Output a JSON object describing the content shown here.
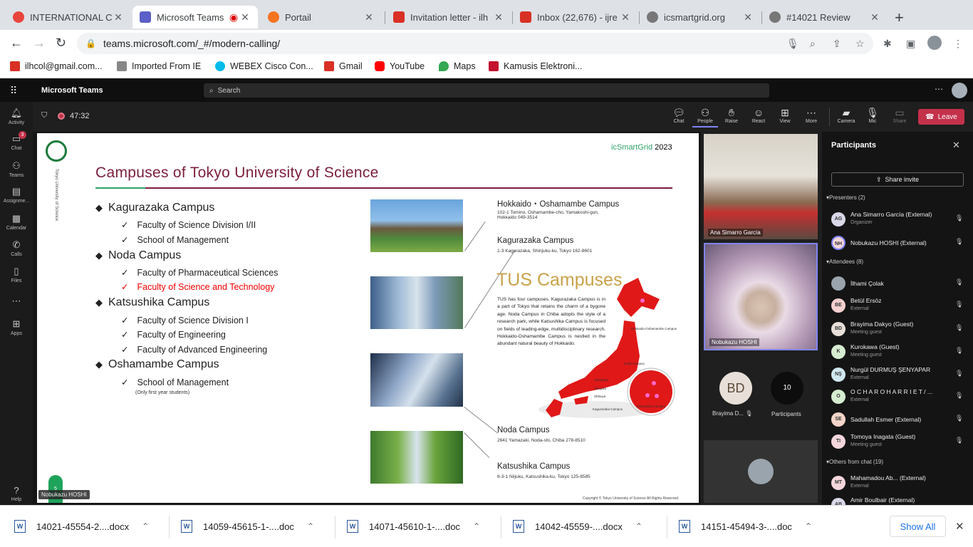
{
  "browser": {
    "tabs": [
      {
        "title": "INTERNATIONAL CO",
        "color": "#e8453c",
        "active": false
      },
      {
        "title": "Microsoft Teams",
        "color": "#5b5fc7",
        "active": true
      },
      {
        "title": "Portail",
        "color": "#f47421",
        "active": false
      },
      {
        "title": "Invitation letter - ilh",
        "color": "#d93025",
        "active": false
      },
      {
        "title": "Inbox (22,676) - ijre",
        "color": "#d93025",
        "active": false
      },
      {
        "title": "icsmartgrid.org",
        "color": "#777777",
        "active": false
      },
      {
        "title": "#14021 Review",
        "color": "#777777",
        "active": false
      }
    ],
    "url": "teams.microsoft.com/_#/modern-calling/",
    "bookmarks": [
      {
        "label": "ilhcol@gmail.com...",
        "color": "#d93025"
      },
      {
        "label": "Imported From IE",
        "color": "#888888"
      },
      {
        "label": "WEBEX Cisco Con...",
        "color": "#00bceb"
      },
      {
        "label": "Gmail",
        "color": "#d93025"
      },
      {
        "label": "YouTube",
        "color": "#ff0000"
      },
      {
        "label": "Maps",
        "color": "#34a853"
      },
      {
        "label": "Kamusis Elektroni...",
        "color": "#c4122f"
      }
    ]
  },
  "teams": {
    "app_name": "Microsoft Teams",
    "search_placeholder": "Search",
    "rail": [
      "Activity",
      "Chat",
      "Teams",
      "Assignme...",
      "Calendar",
      "Calls",
      "Files",
      "Apps",
      "Help"
    ],
    "chat_badge": "3",
    "meeting_time": "47:32",
    "controls": [
      "Chat",
      "People",
      "Raise",
      "React",
      "View",
      "More",
      "Camera",
      "Mic",
      "Share"
    ],
    "leave_label": "Leave"
  },
  "slide": {
    "brand_prefix": "icSmartGrid",
    "brand_year": "2023",
    "vertical_label": "Tokyo University of Science",
    "title": "Campuses of Tokyo University of Science",
    "campuses": [
      {
        "name": "Kagurazaka Campus",
        "faculties": [
          "Faculty of Science Division I/II",
          "School of Management"
        ]
      },
      {
        "name": "Noda Campus",
        "faculties": [
          "Faculty of Pharmaceutical Sciences",
          "Faculty of Science and Technology"
        ]
      },
      {
        "name": "Katsushika Campus",
        "faculties": [
          "Faculty of Science Division I",
          "Faculty of Engineering",
          "Faculty of Advanced Engineering"
        ]
      },
      {
        "name": "Oshamambe Campus",
        "faculties": [
          "School of Management"
        ],
        "note": "(Only first year students)"
      }
    ],
    "locations": [
      {
        "name": "Hokkaido・Oshamambe Campus",
        "address": "102-1 Tomino, Oshamambe-cho, Yamakoshi-gun, Hokkaido 049-3514"
      },
      {
        "name": "Kagurazaka Campus",
        "address": "1-3 Kagurazaka, Shinjuku-ku, Tokyo 162-8601"
      },
      {
        "name": "Noda Campus",
        "address": "2641 Yamazaki, Noda-shi, Chiba 278-8510"
      },
      {
        "name": "Katsushika Campus",
        "address": "6-3-1 Niijuku, Katsushika-ku, Tokyo 125-8585"
      }
    ],
    "tus_heading": "TUS Campuses",
    "tus_text": "TUS has four campuses. Kagurazaka Campus is in a part of Tokyo that retains the charm of a bygone age. Noda Campus in Chiba adopts the style of a research park, while Katsushika Campus is focused on fields of leading-edge, multidisciplinary research. Hokkaido-Oshamambe Campus is nestled in the abundant natural beauty of Hokkaido.",
    "map_labels": [
      "Hokkaido-Oshamambe Campus",
      "Noda Campus",
      "Akihabara",
      "Shinjuku",
      "Shibuya",
      "Kagurazaka Campus",
      "Katsushika Campus"
    ],
    "copyright": "Copyright © Tokyo University of Science All Rights Reserved.",
    "page_number": "5",
    "presenter_tag": "Nobukazu HOSHI"
  },
  "gallery": {
    "video1_name": "Ana Simarro García",
    "video2_name": "Nobukazu HOSHI",
    "bd_initials": "BD",
    "bd_name": "Brayima D...",
    "participant_count": "10",
    "participant_label": "Participants"
  },
  "participants": {
    "title": "Participants",
    "share_invite": "Share invite",
    "presenters_header": "Presenters (2)",
    "attendees_header": "Attendees (8)",
    "others_header": "Others from chat (19)",
    "presenters": [
      {
        "initials": "AG",
        "name": "Ana Simarro García (External)",
        "role": "Organizer",
        "color": "#d8d8e8"
      },
      {
        "initials": "NH",
        "name": "Nobukazu HOSHI (External)",
        "role": "",
        "color": "#f3d6dc"
      }
    ],
    "attendees": [
      {
        "initials": "",
        "name": "İlhami Çolak",
        "role": "",
        "color": "#9aa4ad"
      },
      {
        "initials": "BE",
        "name": "Betül Ersöz",
        "role": "External",
        "color": "#f7d0d0"
      },
      {
        "initials": "BD",
        "name": "Brayima Dakyo (Guest)",
        "role": "Meeting guest",
        "color": "#e8e0d8"
      },
      {
        "initials": "K",
        "name": "Kurokawa (Guest)",
        "role": "Meeting guest",
        "color": "#d6ecd0"
      },
      {
        "initials": "NŞ",
        "name": "Nurgül DURMUŞ ŞENYAPAR",
        "role": "External",
        "color": "#d0e8f0"
      },
      {
        "initials": "O",
        "name": "O C H A R O H A R R I E T / ...",
        "role": "External",
        "color": "#d6ecd0"
      },
      {
        "initials": "SE",
        "name": "Sadullah Esmer (External)",
        "role": "",
        "color": "#f5d5c8"
      },
      {
        "initials": "TI",
        "name": "Tomoya Inagata (Guest)",
        "role": "Meeting guest",
        "color": "#f3d6dc"
      }
    ],
    "others": [
      {
        "initials": "MT",
        "name": "Mahamadou Ab... (External)",
        "role": "External",
        "color": "#f3d6dc"
      },
      {
        "initials": "AB",
        "name": "Amir Boulbair (External)",
        "role": "",
        "color": "#d8d8e8"
      }
    ]
  },
  "downloads": {
    "files": [
      "14021-45554-2....docx",
      "14059-45615-1-....doc",
      "14071-45610-1-....doc",
      "14042-45559-....docx",
      "14151-45494-3-....doc"
    ],
    "show_all": "Show All"
  }
}
